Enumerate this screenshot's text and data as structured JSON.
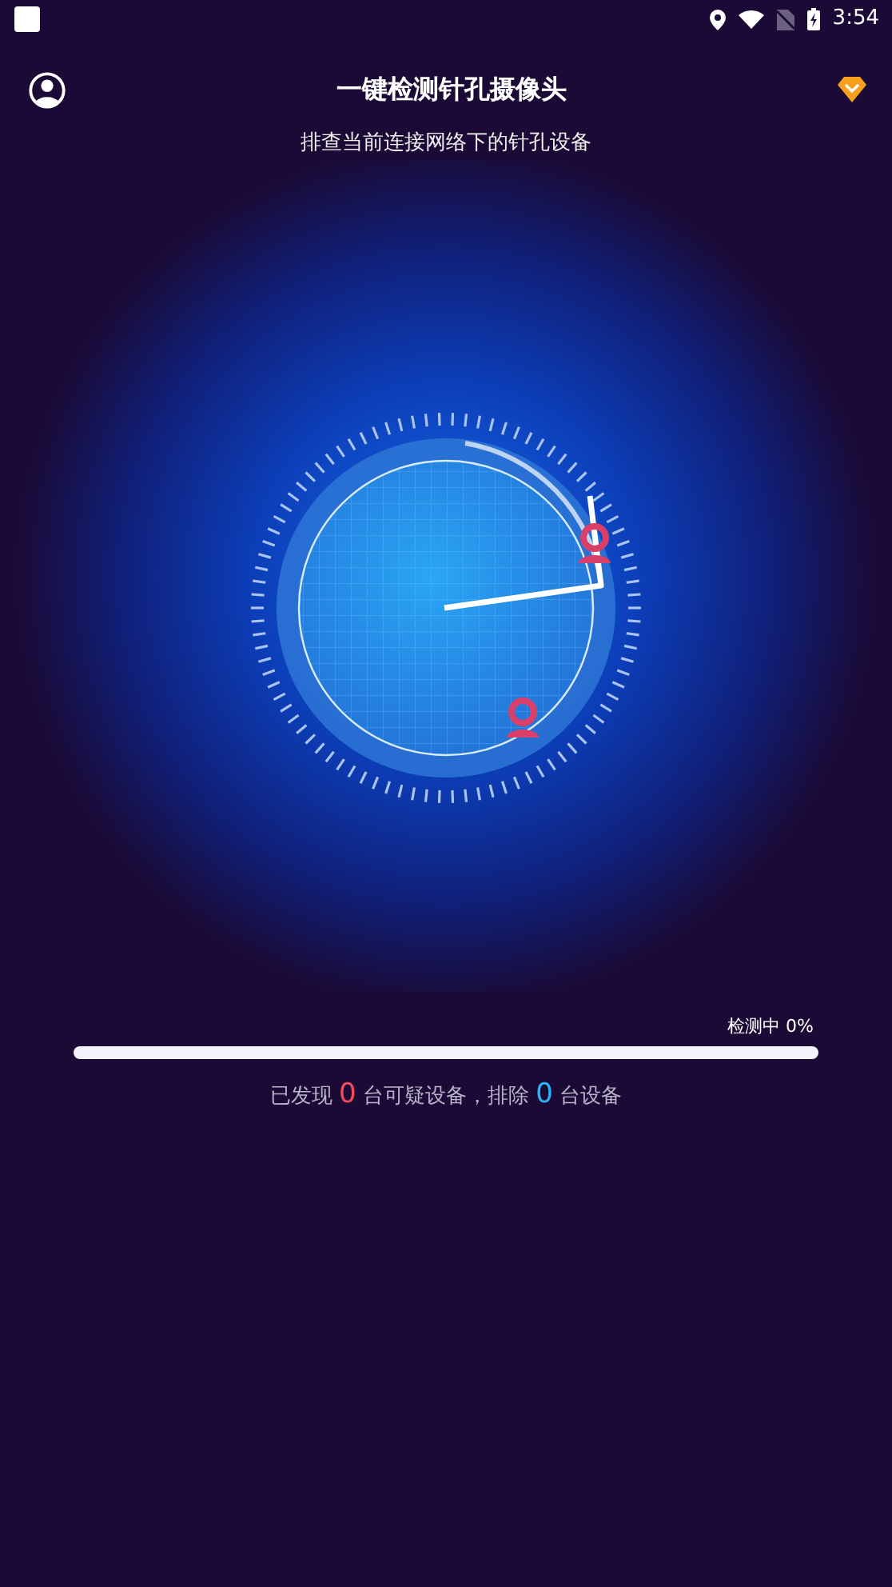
{
  "status_bar": {
    "time": "3:54"
  },
  "header": {
    "title": "一键检测针孔摄像头",
    "subtitle": "排查当前连接网络下的针孔设备"
  },
  "scan": {
    "status": "检测中 0%",
    "level": 0
  },
  "result": {
    "parts": [
      {
        "kind": "text",
        "text": "已发现 "
      },
      {
        "kind": "suspicious",
        "text": "0"
      },
      {
        "kind": "text",
        "text": " 台可疑设备，排除 "
      },
      {
        "kind": "cleared",
        "text": "0"
      },
      {
        "kind": "text",
        "text": " 台设备"
      }
    ]
  }
}
